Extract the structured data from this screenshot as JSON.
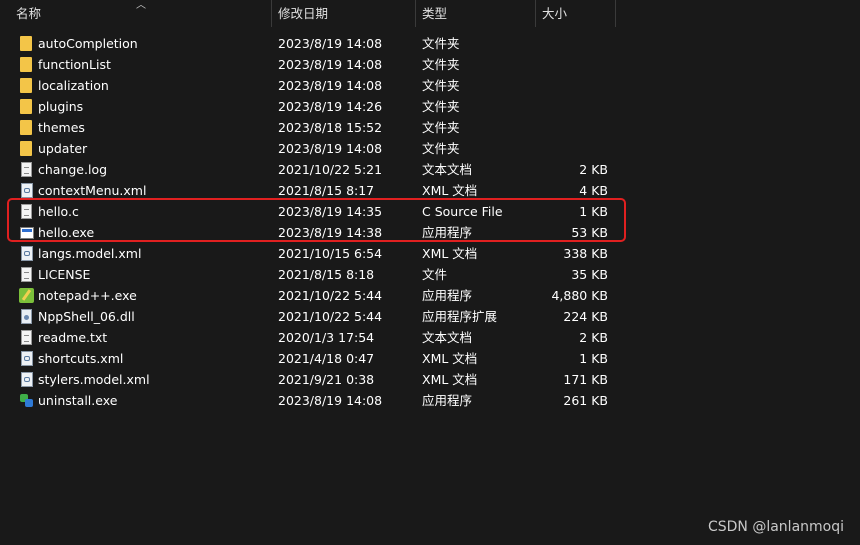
{
  "columns": {
    "name": "名称",
    "date_modified": "修改日期",
    "type": "类型",
    "size": "大小"
  },
  "files": [
    {
      "name": "autoCompletion",
      "date": "2023/8/19 14:08",
      "type": "文件夹",
      "size": "",
      "icon": "folder-icon"
    },
    {
      "name": "functionList",
      "date": "2023/8/19 14:08",
      "type": "文件夹",
      "size": "",
      "icon": "folder-icon"
    },
    {
      "name": "localization",
      "date": "2023/8/19 14:08",
      "type": "文件夹",
      "size": "",
      "icon": "folder-icon"
    },
    {
      "name": "plugins",
      "date": "2023/8/19 14:26",
      "type": "文件夹",
      "size": "",
      "icon": "folder-icon"
    },
    {
      "name": "themes",
      "date": "2023/8/18 15:52",
      "type": "文件夹",
      "size": "",
      "icon": "folder-icon"
    },
    {
      "name": "updater",
      "date": "2023/8/19 14:08",
      "type": "文件夹",
      "size": "",
      "icon": "folder-icon"
    },
    {
      "name": "change.log",
      "date": "2021/10/22 5:21",
      "type": "文本文档",
      "size": "2 KB",
      "icon": "text-file-icon"
    },
    {
      "name": "contextMenu.xml",
      "date": "2021/8/15 8:17",
      "type": "XML 文档",
      "size": "4 KB",
      "icon": "xml-file-icon"
    },
    {
      "name": "hello.c",
      "date": "2023/8/19 14:35",
      "type": "C Source File",
      "size": "1 KB",
      "icon": "text-file-icon"
    },
    {
      "name": "hello.exe",
      "date": "2023/8/19 14:38",
      "type": "应用程序",
      "size": "53 KB",
      "icon": "application-icon"
    },
    {
      "name": "langs.model.xml",
      "date": "2021/10/15 6:54",
      "type": "XML 文档",
      "size": "338 KB",
      "icon": "xml-file-icon"
    },
    {
      "name": "LICENSE",
      "date": "2021/8/15 8:18",
      "type": "文件",
      "size": "35 KB",
      "icon": "text-file-icon"
    },
    {
      "name": "notepad++.exe",
      "date": "2021/10/22 5:44",
      "type": "应用程序",
      "size": "4,880 KB",
      "icon": "notepad-plus-plus-icon"
    },
    {
      "name": "NppShell_06.dll",
      "date": "2021/10/22 5:44",
      "type": "应用程序扩展",
      "size": "224 KB",
      "icon": "dll-file-icon"
    },
    {
      "name": "readme.txt",
      "date": "2020/1/3 17:54",
      "type": "文本文档",
      "size": "2 KB",
      "icon": "text-file-icon"
    },
    {
      "name": "shortcuts.xml",
      "date": "2021/4/18 0:47",
      "type": "XML 文档",
      "size": "1 KB",
      "icon": "xml-file-icon"
    },
    {
      "name": "stylers.model.xml",
      "date": "2021/9/21 0:38",
      "type": "XML 文档",
      "size": "171 KB",
      "icon": "xml-file-icon"
    },
    {
      "name": "uninstall.exe",
      "date": "2023/8/19 14:08",
      "type": "应用程序",
      "size": "261 KB",
      "icon": "uninstaller-icon"
    }
  ],
  "highlight_color": "#e02020",
  "watermark": "CSDN @lanlanmoqi"
}
